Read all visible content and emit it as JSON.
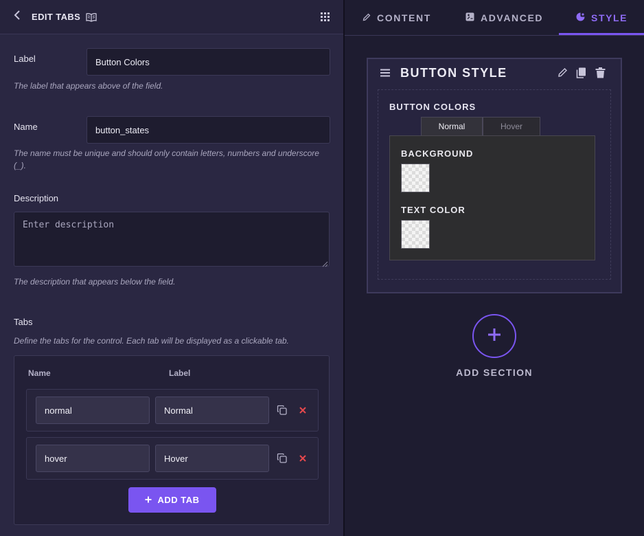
{
  "left_panel": {
    "header": {
      "title": "EDIT TABS"
    },
    "label_field": {
      "label": "Label",
      "value": "Button Colors",
      "help": "The label that appears above of the field."
    },
    "name_field": {
      "label": "Name",
      "value": "button_states",
      "help": "The name must be unique and should only contain letters, numbers and underscore (_)."
    },
    "description_field": {
      "label": "Description",
      "placeholder": "Enter description",
      "help": "The description that appears below the field."
    },
    "tabs_field": {
      "label": "Tabs",
      "help": "Define the tabs for the control. Each tab will be displayed as a clickable tab.",
      "columns": {
        "name": "Name",
        "label": "Label"
      },
      "rows": [
        {
          "name": "normal",
          "label": "Normal"
        },
        {
          "name": "hover",
          "label": "Hover"
        }
      ],
      "add_button": "ADD TAB"
    }
  },
  "right_panel": {
    "nav": [
      {
        "label": "CONTENT",
        "icon": "pencil-icon",
        "active": false
      },
      {
        "label": "ADVANCED",
        "icon": "advanced-icon",
        "active": false
      },
      {
        "label": "STYLE",
        "icon": "palette-icon",
        "active": true
      }
    ],
    "section": {
      "title": "BUTTON STYLE",
      "control_label": "BUTTON COLORS",
      "tabs": [
        {
          "label": "Normal",
          "active": true
        },
        {
          "label": "Hover",
          "active": false
        }
      ],
      "colors": [
        {
          "label": "BACKGROUND"
        },
        {
          "label": "TEXT COLOR"
        }
      ]
    },
    "add_section_label": "ADD SECTION"
  },
  "colors": {
    "accent": "#7a55f0",
    "danger": "#e5484d",
    "panel_bg": "#2a2742"
  }
}
